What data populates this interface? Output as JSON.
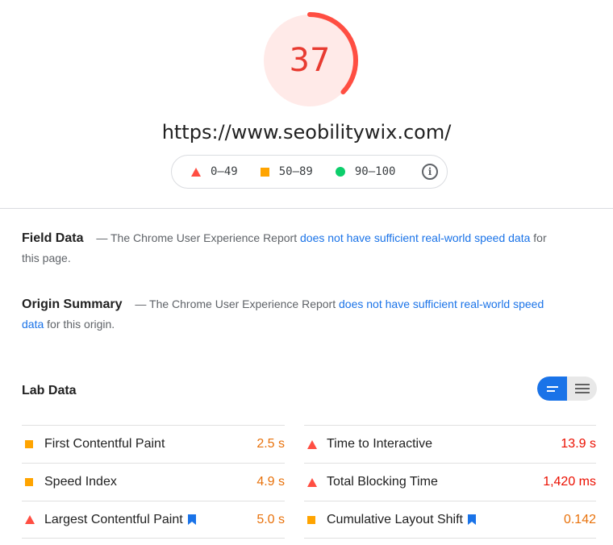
{
  "score": {
    "value": "37",
    "fraction": 0.37,
    "color": "#ff4e42",
    "bg_color": "#ffeae8"
  },
  "url": "https://www.seobilitywix.com/",
  "legend": {
    "items": [
      {
        "icon": "triangle-red",
        "label": "0–49"
      },
      {
        "icon": "square-orange",
        "label": "50–89"
      },
      {
        "icon": "circle-green",
        "label": "90–100"
      }
    ],
    "info_icon": "info-icon"
  },
  "field_data": {
    "title": "Field Data",
    "dash": "—",
    "text_before": "The Chrome User Experience Report",
    "link_text": "does not have sufficient real-world speed data",
    "text_after": "for this page."
  },
  "origin_summary": {
    "title": "Origin Summary",
    "dash": "—",
    "text_before": "The Chrome User Experience Report",
    "link_text": "does not have sufficient real-world speed data",
    "text_after": "for this origin."
  },
  "lab_data": {
    "title": "Lab Data",
    "toggle": {
      "active": "bar-view",
      "options": [
        "bar-view-icon",
        "list-view-icon"
      ]
    },
    "left_metrics": [
      {
        "icon": "square-orange",
        "label": "First Contentful Paint",
        "value": "2.5 s",
        "status": "average",
        "bookmark": false
      },
      {
        "icon": "square-orange",
        "label": "Speed Index",
        "value": "4.9 s",
        "status": "average",
        "bookmark": false
      },
      {
        "icon": "triangle-red",
        "label": "Largest Contentful Paint",
        "value": "5.0 s",
        "status": "average",
        "bookmark": true
      }
    ],
    "right_metrics": [
      {
        "icon": "triangle-red",
        "label": "Time to Interactive",
        "value": "13.9 s",
        "status": "fail",
        "bookmark": false
      },
      {
        "icon": "triangle-red",
        "label": "Total Blocking Time",
        "value": "1,420 ms",
        "status": "fail",
        "bookmark": false
      },
      {
        "icon": "square-orange",
        "label": "Cumulative Layout Shift",
        "value": "0.142",
        "status": "average",
        "bookmark": true
      }
    ]
  },
  "colors": {
    "fail": "#ff4e42",
    "average": "#ffa400",
    "pass": "#0cce6b",
    "link": "#1a73e8",
    "value_orange": "#e8710a",
    "value_red": "#eb0f00",
    "accent_blue": "#1a73e8"
  }
}
